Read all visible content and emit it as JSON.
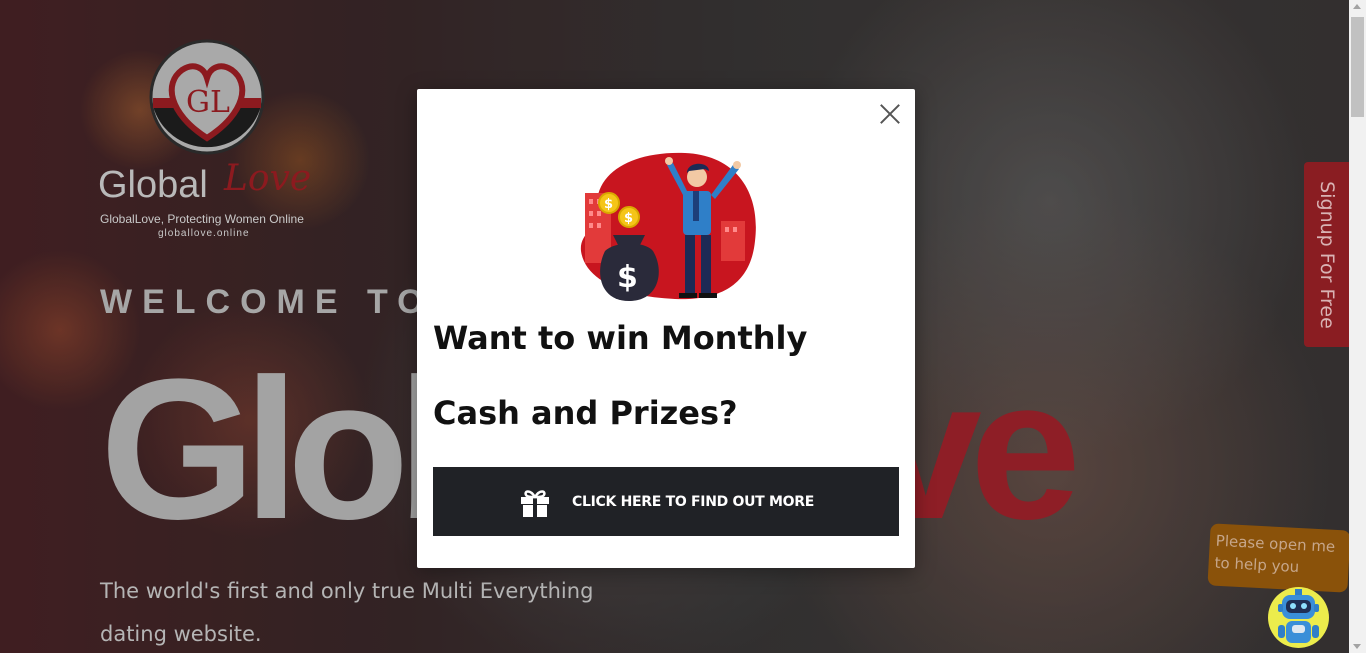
{
  "brand": {
    "logo_initials": "GL",
    "logo_word": "Global",
    "logo_script": "Love",
    "tagline": "GlobalLove, Protecting Women Online",
    "domain": "globallove.online"
  },
  "hero": {
    "welcome": "WELCOME TO",
    "brand_part_a": "Global",
    "brand_part_b": "Love",
    "lead": "The world's first and only true Multi Everything dating website."
  },
  "side_tab": {
    "label": "Signup For Free"
  },
  "help": {
    "bubble_text": "Please open me to help you",
    "bot_icon": "robot-icon"
  },
  "modal": {
    "close_icon": "close-icon",
    "illustration": "money-winner-illustration",
    "title": "Want to win Monthly Cash and Prizes?",
    "cta_icon": "gift-icon",
    "cta_label": "CLICK HERE TO FIND OUT MORE"
  },
  "colors": {
    "brand_red": "#8e1e26",
    "cta_bg": "#202226",
    "help_bubble": "#8a520a",
    "bot_yellow": "#ecec4c"
  }
}
